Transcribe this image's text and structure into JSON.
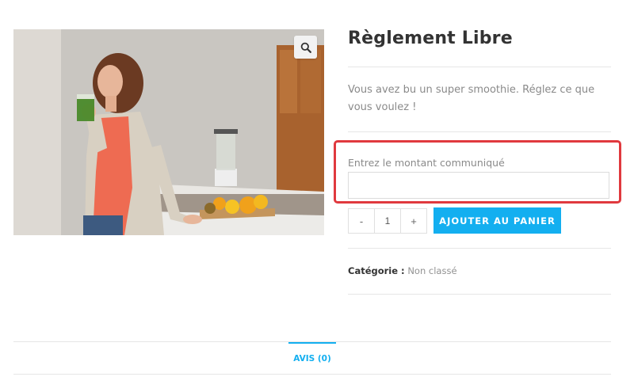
{
  "product": {
    "title": "Règlement Libre",
    "description": "Vous avez bu un super smoothie. Réglez ce que vous voulez !",
    "image_alt": "Woman drinking green smoothie in kitchen"
  },
  "amount_field": {
    "label": "Entrez le montant communiqué",
    "value": "",
    "placeholder": ""
  },
  "quantity": {
    "minus": "-",
    "value": "1",
    "plus": "+"
  },
  "add_to_cart": {
    "label": "Ajouter au panier"
  },
  "meta": {
    "category_key": "Catégorie :",
    "category_value": "Non classé"
  },
  "tabs": [
    {
      "label": "AVIS (0)",
      "active": true
    }
  ],
  "colors": {
    "accent": "#13aff0",
    "highlight": "#e0393e"
  },
  "icons": {
    "zoom": "magnifier-icon"
  }
}
